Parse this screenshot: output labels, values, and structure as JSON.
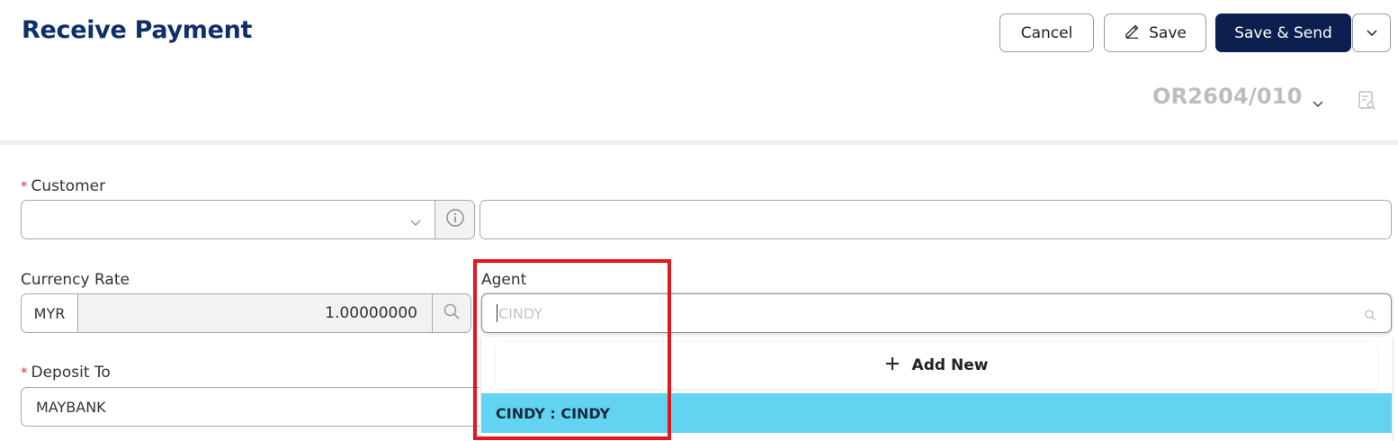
{
  "header": {
    "title": "Receive Payment",
    "buttons": {
      "cancel": "Cancel",
      "save": "Save",
      "save_send": "Save & Send"
    }
  },
  "document": {
    "number": "OR2604/010"
  },
  "form": {
    "customer": {
      "label": "Customer",
      "required_mark": "*",
      "value": "",
      "name_value": ""
    },
    "currency_rate": {
      "label": "Currency Rate",
      "code": "MYR",
      "rate": "1.00000000"
    },
    "agent": {
      "label": "Agent",
      "placeholder": "CINDY",
      "dropdown": {
        "add_new": "Add New",
        "options": [
          "CINDY : CINDY"
        ]
      }
    },
    "deposit_to": {
      "label": "Deposit To",
      "required_mark": "*",
      "value": "MAYBANK"
    }
  },
  "colors": {
    "primary": "#0d1f4f",
    "title": "#10306b",
    "highlight_option": "#63d3f2",
    "annotation": "#e3171c",
    "required": "#e03535"
  },
  "icons": [
    "pencil-icon",
    "chevron-down-icon",
    "document-preview-icon",
    "info-icon",
    "search-icon",
    "plus-icon"
  ]
}
